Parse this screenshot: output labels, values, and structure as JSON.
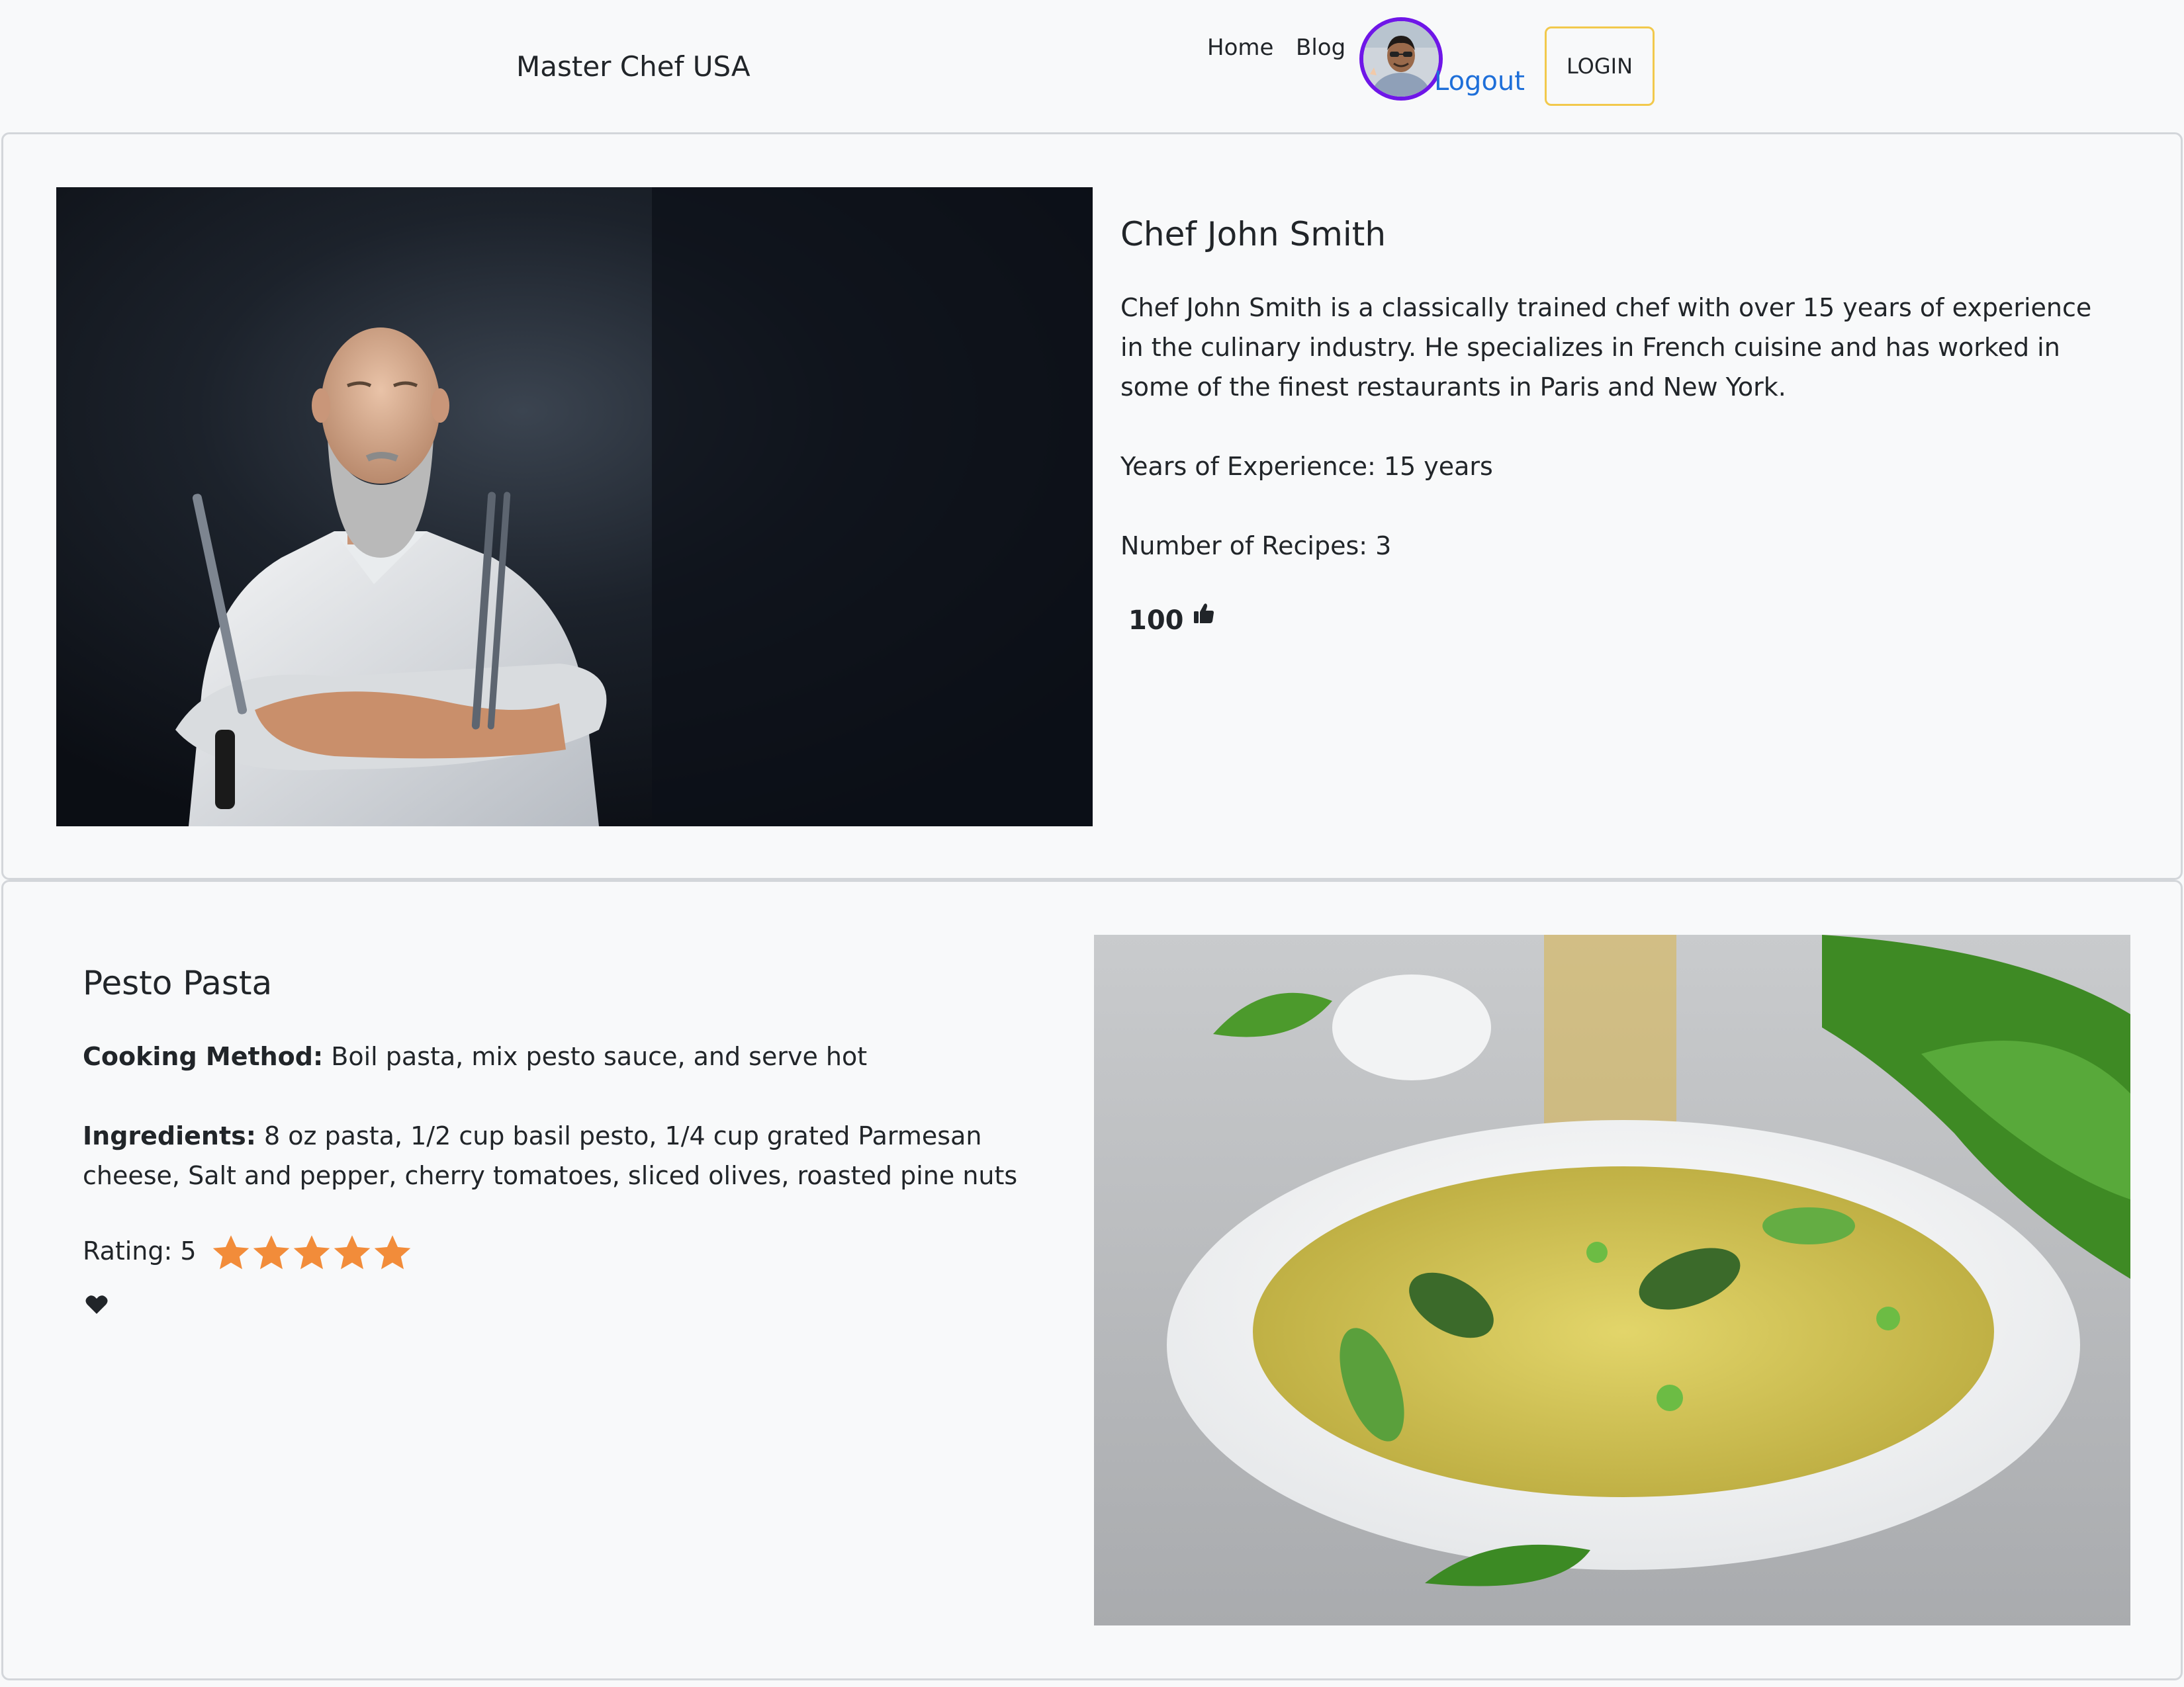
{
  "navbar": {
    "brand": "Master Chef USA",
    "links": [
      {
        "label": "Home",
        "icon": ""
      },
      {
        "label": "Blog",
        "icon": ""
      }
    ],
    "avatar_icon": "user-avatar",
    "logout_label": "Logout",
    "login_label": "LOGIN",
    "colors": {
      "avatar_ring": "#6f16e8",
      "logout": "#1e6fd9",
      "login_border": "#f2c94c"
    }
  },
  "chef": {
    "name": "Chef John Smith",
    "bio": "Chef John Smith is a classically trained chef with over 15 years of experience in the culinary industry. He specializes in French cuisine and has worked in some of the finest restaurants in Paris and New York.",
    "experience": "Years of Experience: 15 years",
    "recipes": "Number of Recipes: 3",
    "likes": "100",
    "like_icon": "thumbs-up-icon"
  },
  "recipe": {
    "title": "Pesto Pasta",
    "method_label": "Cooking Method:",
    "method": " Boil pasta, mix pesto sauce, and serve hot",
    "ingredients_label": "Ingredients:",
    "ingredients": " 8 oz pasta, 1/2 cup basil pesto, 1/4 cup grated Parmesan cheese, Salt and pepper, cherry tomatoes, sliced olives, roasted pine nuts",
    "rating_label": "Rating: 5",
    "rating": 5,
    "rating_max": 5,
    "star_color": "#f28c3a",
    "favorite_icon": "heart-icon"
  }
}
